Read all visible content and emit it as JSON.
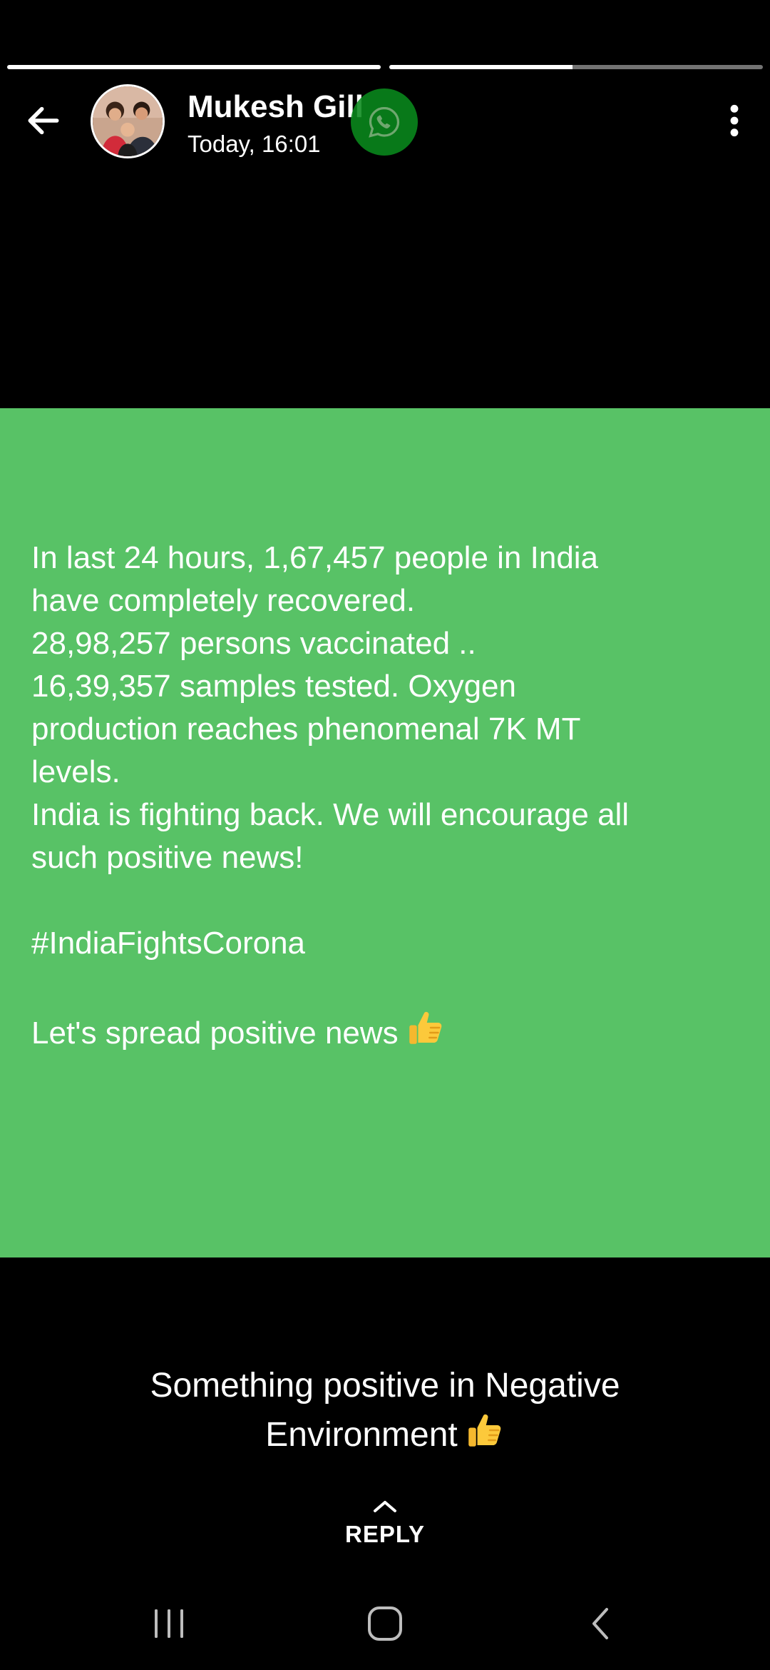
{
  "story": {
    "progress": [
      1.0,
      0.49
    ]
  },
  "header": {
    "contact_name": "Mukesh Gill",
    "timestamp": "Today, 16:01",
    "back_icon": "arrow-left-icon",
    "badge_icon": "whatsapp-icon",
    "menu_icon": "more-vertical-icon"
  },
  "status": {
    "background_color": "#58c266",
    "lines": [
      "In last 24 hours, 1,67,457 people in India",
      "have completely recovered.",
      "28,98,257 persons vaccinated ..",
      "16,39,357 samples tested. Oxygen",
      "production reaches phenomenal 7K MT",
      "levels.",
      "India is fighting back. We will encourage all",
      "such positive news!"
    ],
    "hashtag": "#IndiaFightsCorona",
    "closing": "Let's spread positive news"
  },
  "caption": {
    "line1": "Something positive in Negative",
    "line2": "Environment"
  },
  "reply": {
    "label": "REPLY",
    "icon": "chevron-up-icon"
  },
  "navbar": {
    "recents_icon": "recents-icon",
    "home_icon": "home-icon",
    "back_icon": "nav-back-icon"
  }
}
